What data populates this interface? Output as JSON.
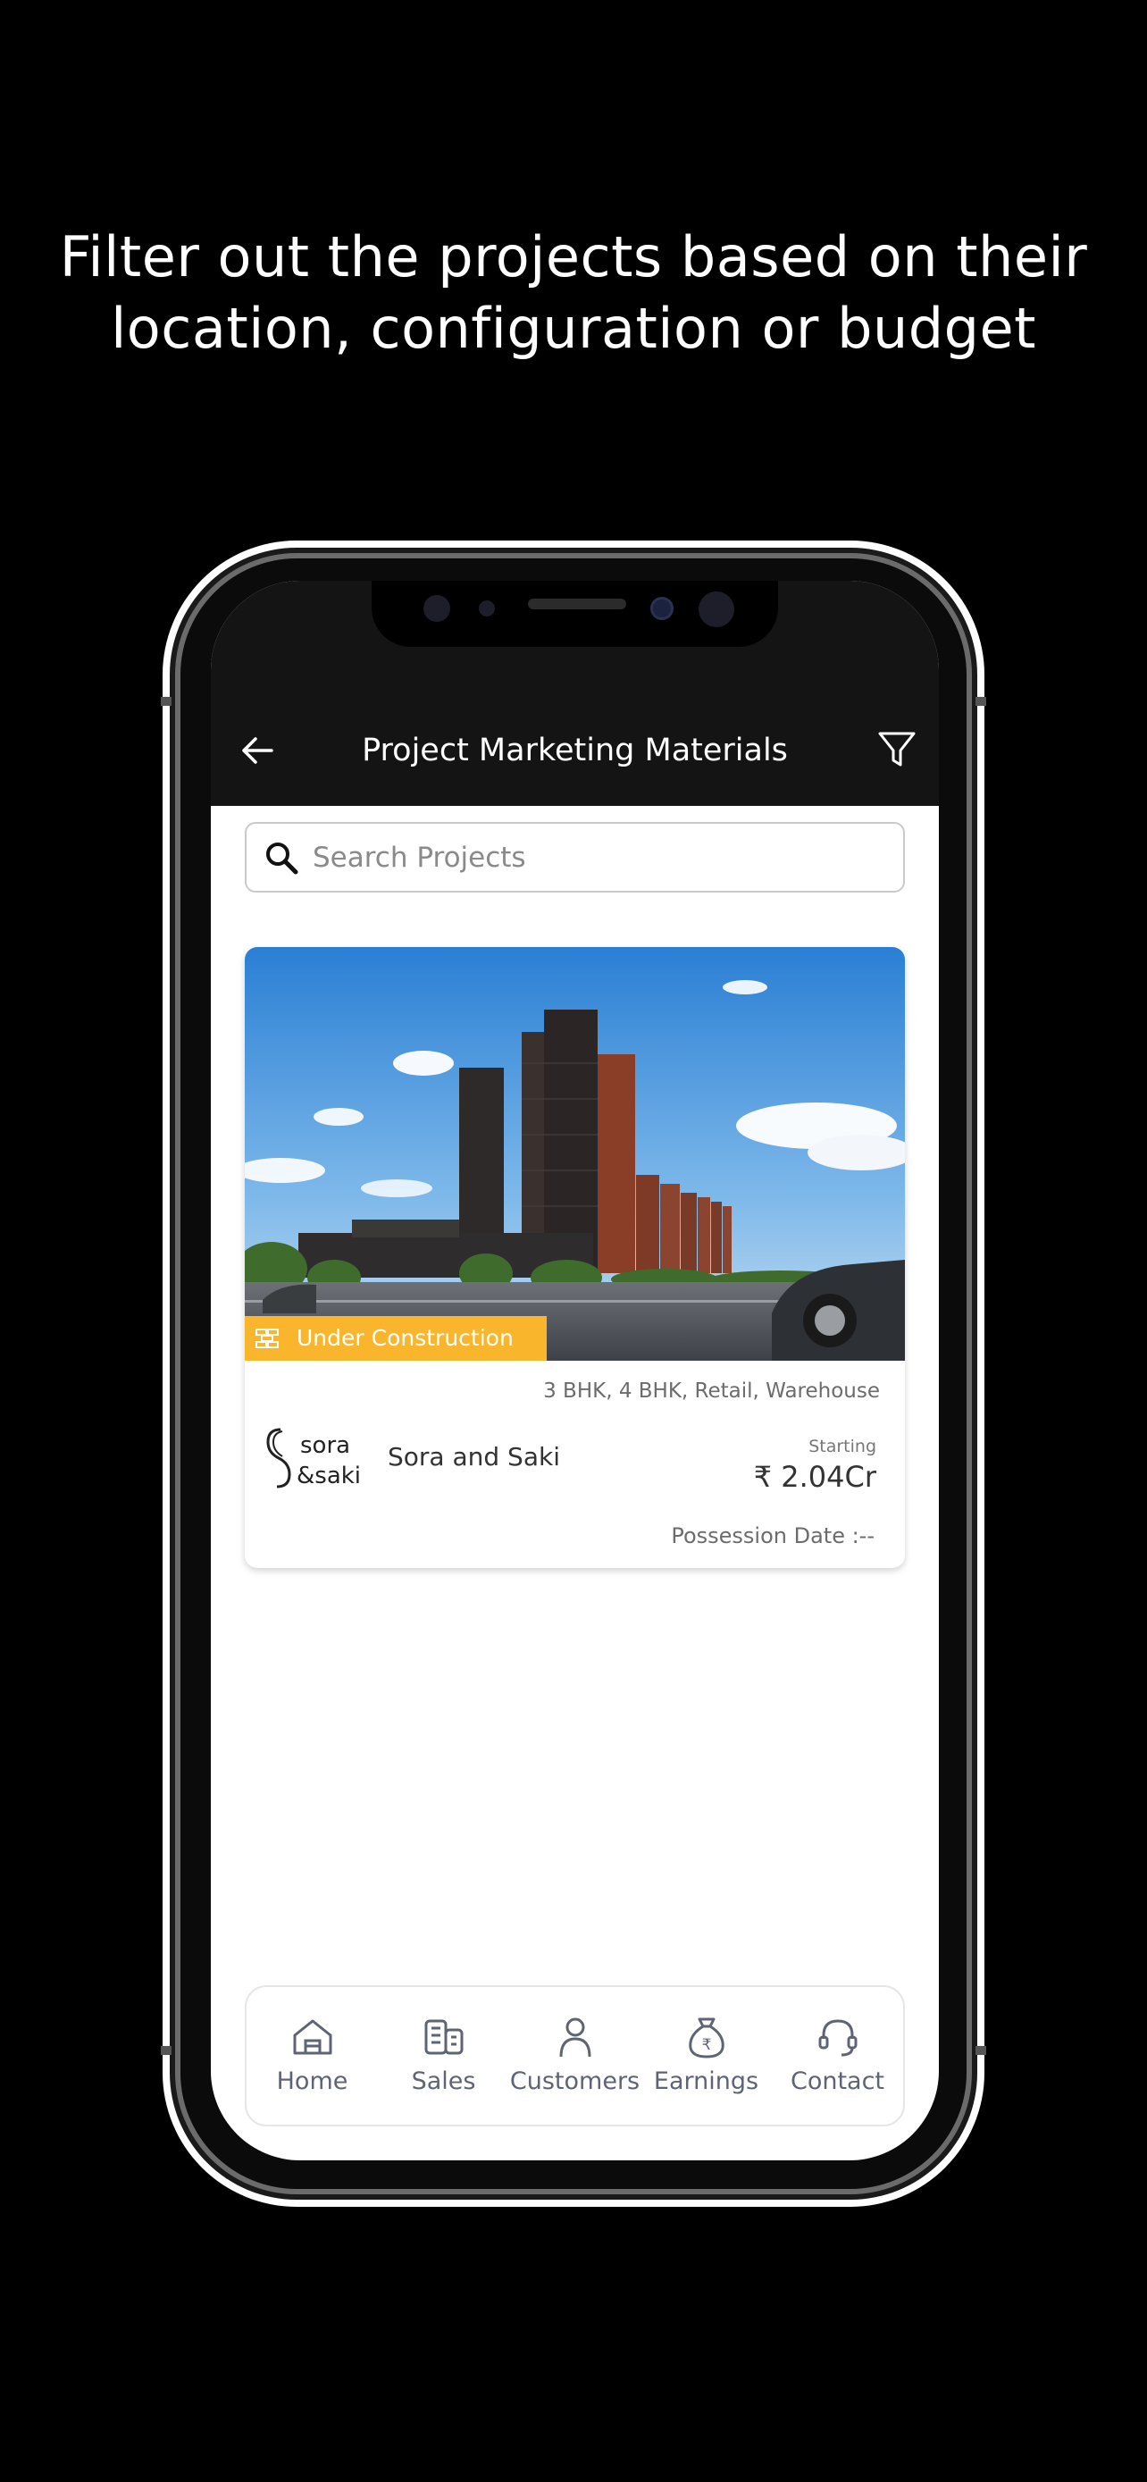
{
  "promo": {
    "headline_line1": "Filter out the projects based on their",
    "headline_line2": "location, configuration or budget"
  },
  "header": {
    "title": "Project Marketing Materials",
    "back_icon": "arrow-left-icon",
    "filter_icon": "filter-funnel-icon"
  },
  "search": {
    "placeholder": "Search Projects",
    "value": ""
  },
  "project_card": {
    "status": "Under Construction",
    "configurations": "3 BHK, 4 BHK, Retail, Warehouse",
    "logo_text_line1": "sora",
    "logo_text_line2": "&saki",
    "name": "Sora and Saki",
    "starting_label": "Starting",
    "price": "₹ 2.04Cr",
    "possession": "Possession Date :--"
  },
  "bottom_nav": {
    "items": [
      {
        "label": "Home",
        "icon": "home-icon"
      },
      {
        "label": "Sales",
        "icon": "building-icon"
      },
      {
        "label": "Customers",
        "icon": "person-icon"
      },
      {
        "label": "Earnings",
        "icon": "money-bag-icon"
      },
      {
        "label": "Contact",
        "icon": "headset-icon"
      }
    ]
  },
  "colors": {
    "background": "#000000",
    "header_bg": "#141414",
    "status_badge": "#f9b52b",
    "nav_text": "#5f6475"
  }
}
